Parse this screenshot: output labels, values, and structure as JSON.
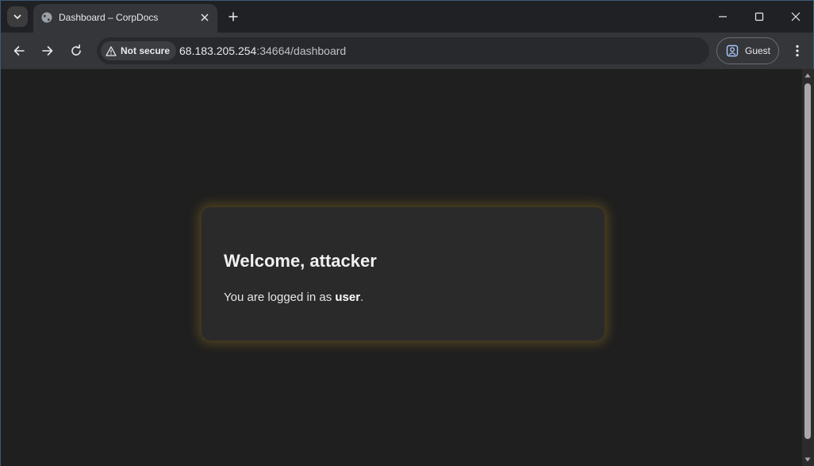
{
  "tab": {
    "title": "Dashboard – CorpDocs"
  },
  "toolbar": {
    "security_label": "Not secure",
    "url_host": "68.183.205.254",
    "url_rest": ":34664/dashboard",
    "profile_label": "Guest"
  },
  "page": {
    "welcome_title": "Welcome, attacker",
    "login_prefix": "You are logged in as ",
    "login_user": "user",
    "login_suffix": "."
  },
  "icons": [
    "tab-search-icon",
    "globe-icon",
    "close-icon",
    "plus-icon",
    "minimize-icon",
    "maximize-icon",
    "close-window-icon",
    "back-arrow-icon",
    "forward-arrow-icon",
    "reload-icon",
    "warning-icon",
    "profile-icon",
    "kebab-menu-icon"
  ],
  "colors": {
    "card_glow": "#dcaa28",
    "background": "#1f1f1f",
    "card": "#2a2a2a"
  }
}
